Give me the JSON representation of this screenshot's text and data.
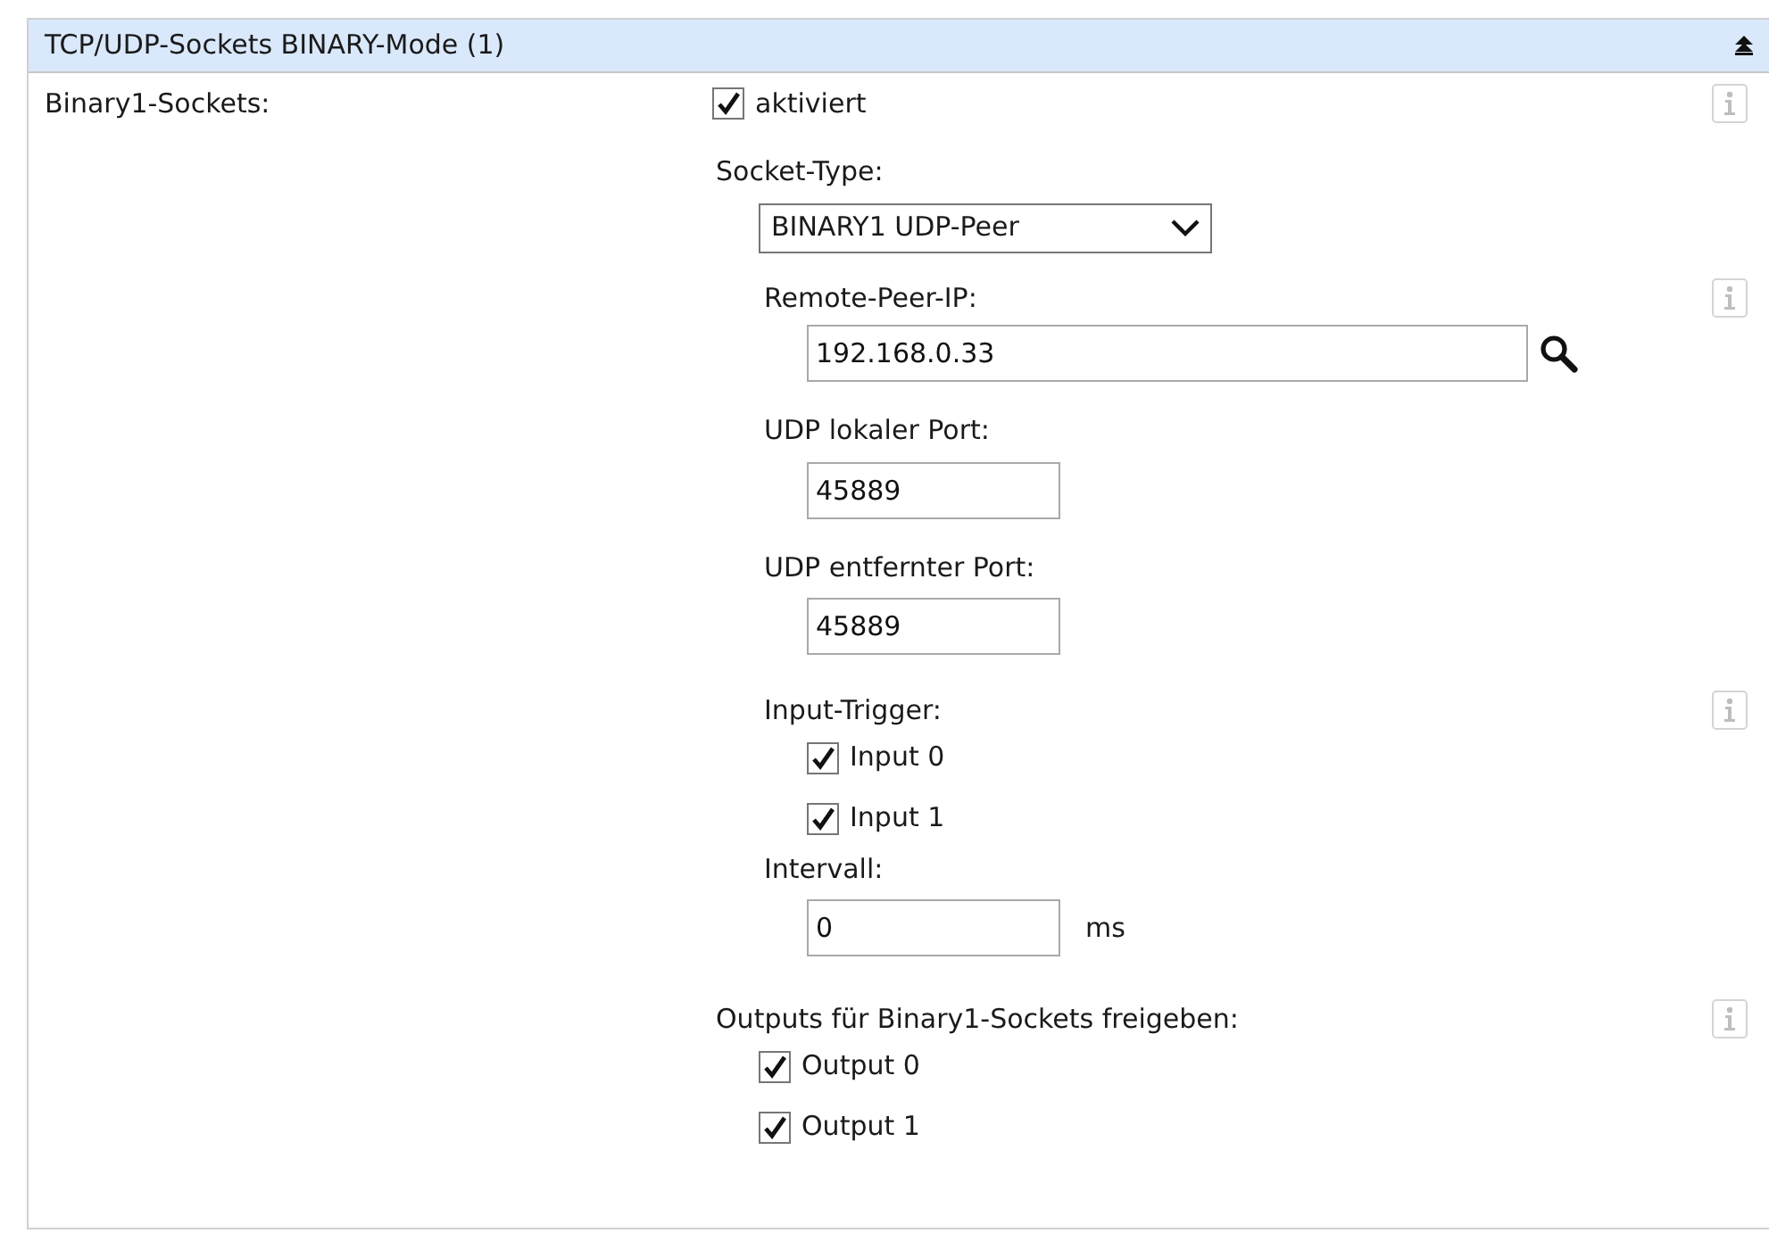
{
  "panel": {
    "title": "TCP/UDP-Sockets BINARY-Mode (1)",
    "expanded": true
  },
  "label": "Binary1-Sockets:",
  "enable": {
    "label": "aktiviert",
    "checked": true
  },
  "socket_type": {
    "label": "Socket-Type:",
    "value": "BINARY1 UDP-Peer"
  },
  "remote_peer_ip": {
    "label": "Remote-Peer-IP:",
    "value": "192.168.0.33"
  },
  "udp_local_port": {
    "label": "UDP lokaler Port:",
    "value": "45889"
  },
  "udp_remote_port": {
    "label": "UDP entfernter Port:",
    "value": "45889"
  },
  "input_trigger": {
    "label": "Input-Trigger:",
    "options": [
      {
        "label": "Input 0",
        "checked": true
      },
      {
        "label": "Input 1",
        "checked": true
      }
    ]
  },
  "interval": {
    "label": "Intervall:",
    "value": "0",
    "unit": "ms"
  },
  "outputs": {
    "label": "Outputs für Binary1-Sockets freigeben:",
    "options": [
      {
        "label": "Output 0",
        "checked": true
      },
      {
        "label": "Output 1",
        "checked": true
      }
    ]
  }
}
